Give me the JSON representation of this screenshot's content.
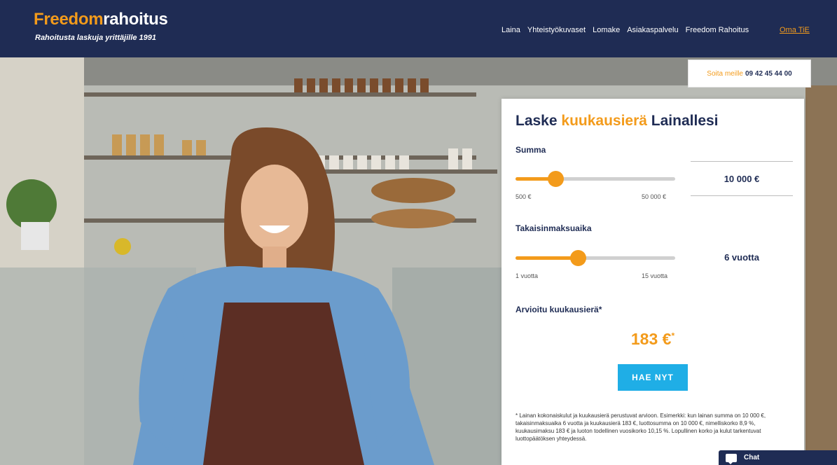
{
  "header": {
    "logo_part1": "Freedom",
    "logo_part2": "rahoitus",
    "tagline": "Rahoitusta laskuja yrittäjille 1991",
    "nav": [
      "Laina",
      "Yhteistyökuvaset",
      "Lomake",
      "Asiakaspalvelu",
      "Freedom Rahoitus"
    ],
    "language": "Oma TiE"
  },
  "phone": {
    "label": "Soita meille",
    "number": "09 42 45 44 00"
  },
  "calculator": {
    "title_part1": "Laske ",
    "title_highlight": "kuukausierä",
    "title_part2": " Lainallesi",
    "amount": {
      "label": "Summa",
      "min_label": "500 €",
      "max_label": "50 000 €",
      "value": "10 000 €",
      "fill_fraction": 0.25
    },
    "period": {
      "label": "Takaisinmaksuaika",
      "min_label": "1 vuotta",
      "max_label": "15 vuotta",
      "value": "6 vuotta",
      "fill_fraction": 0.39
    },
    "monthly_label": "Arvioitu kuukausierä*",
    "monthly_value": "183 €",
    "monthly_note": "*",
    "apply_label": "HAE NYT",
    "disclaimer": "* Lainan kokonaiskulut ja kuukausierä perustuvat arvioon. Esimerkki: kun lainan summa on 10 000 €, takaisinmaksuaika 6 vuotta ja kuukausierä 183 €, luottosumma on 10 000 €, nimelliskorko 8,9 %, kuukausimaksu 183 € ja luoton todellinen vuosikorko 10,15 %. Lopullinen korko ja kulut tarkentuvat luottopäätöksen yhteydessä."
  },
  "chat": {
    "label": "Chat"
  },
  "colors": {
    "navy": "#1f2c54",
    "orange": "#f39b1b",
    "button": "#1faee6"
  }
}
